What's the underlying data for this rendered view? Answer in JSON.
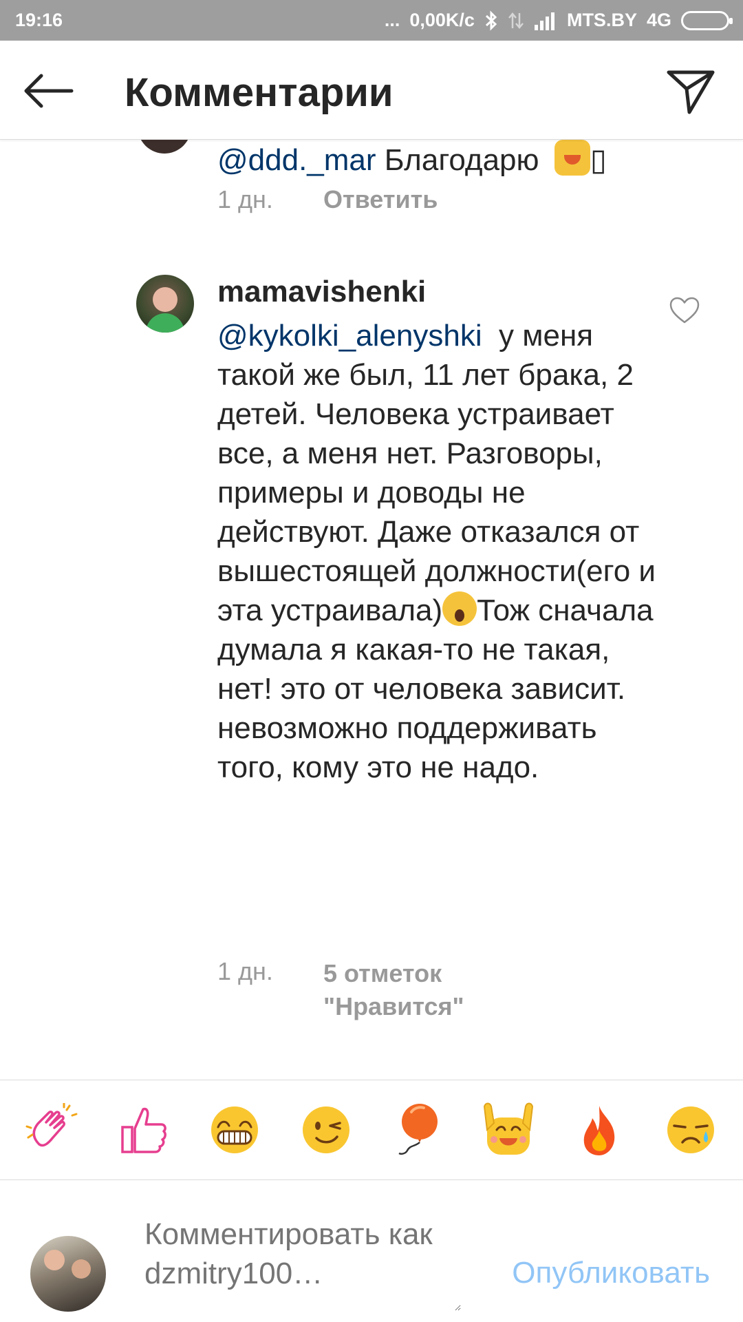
{
  "status_bar": {
    "time": "19:16",
    "dots": "...",
    "speed": "0,00K/c",
    "carrier": "MTS.BY",
    "network": "4G",
    "icons": [
      "bluetooth-icon",
      "data-transfer-icon",
      "signal-icon",
      "battery-icon"
    ]
  },
  "header": {
    "title": "Комментарии",
    "back_icon": "arrow-left-icon",
    "share_icon": "send-icon"
  },
  "previous_comment": {
    "mention": "@ddd._mar",
    "text": " Благодарю ",
    "trailing_char": "▯",
    "time": "1 дн.",
    "reply_label": "Ответить"
  },
  "comment": {
    "username": "mamavishenki",
    "mention": "@kykolki_alenyshki",
    "text_before_emoji": "  у меня такой же был, 11 лет брака, 2 детей. Человека устраивает все, а меня нет. Разговоры, примеры и доводы не действуют. Даже отказался от вышестоящей должности(его и эта устраивала)",
    "text_after_emoji": "Тож сначала думала я какая-то не такая, нет! это от человека зависит. невозможно поддерживать того, кому это не надо.",
    "time": "1 дн.",
    "likes_line1": "5 отметок",
    "likes_line2": "\"Нравится\""
  },
  "emoji_bar": [
    {
      "name": "clapping-hands-emoji",
      "glyph": "👏"
    },
    {
      "name": "thumbs-up-emoji",
      "glyph": "👍"
    },
    {
      "name": "grinning-face-emoji",
      "glyph": "😁"
    },
    {
      "name": "winking-face-emoji",
      "glyph": "😉"
    },
    {
      "name": "balloon-emoji",
      "glyph": "🎈"
    },
    {
      "name": "raising-hands-face-emoji",
      "glyph": "🙌"
    },
    {
      "name": "fire-emoji",
      "glyph": "🔥"
    },
    {
      "name": "sad-face-emoji",
      "glyph": "😢"
    }
  ],
  "composer": {
    "placeholder": "Комментировать как dzmitry100…",
    "publish_label": "Опубликовать"
  },
  "colors": {
    "status_bar_bg": "#9e9e9e",
    "mention": "#003569",
    "meta_gray": "#999999",
    "publish_blue": "#3897f0"
  }
}
